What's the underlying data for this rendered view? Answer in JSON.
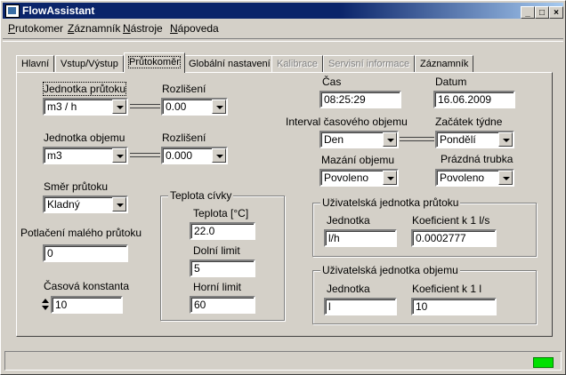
{
  "window": {
    "title": "FlowAssistant",
    "minimize": "_",
    "maximize": "□",
    "close": "×"
  },
  "menu": [
    {
      "label": "Prutokomer",
      "accel": "P",
      "rest": "rutokomer"
    },
    {
      "label": "Záznamník",
      "accel": "Z",
      "rest": "áznamník"
    },
    {
      "label": "Nástroje",
      "accel": "N",
      "rest": "ástroje"
    },
    {
      "label": "Nápoveda",
      "accel": "N",
      "rest": "ápoveda"
    }
  ],
  "tabs": [
    {
      "label": "Hlavní",
      "state": "normal"
    },
    {
      "label": "Vstup/Výstup",
      "state": "normal"
    },
    {
      "label": "Průtokoměr",
      "state": "active"
    },
    {
      "label": "Globální nastavení",
      "state": "normal"
    },
    {
      "label": "Kalibrace",
      "state": "disabled"
    },
    {
      "label": "Servisní informace",
      "state": "disabled"
    },
    {
      "label": "Záznamník",
      "state": "normal"
    }
  ],
  "flow_unit": {
    "label": "Jednotka průtoku",
    "value": "m3 / h",
    "res_label": "Rozlišení",
    "res_value": "0.00"
  },
  "volume_unit": {
    "label": "Jednotka objemu",
    "value": "m3",
    "res_label": "Rozlišení",
    "res_value": "0.000"
  },
  "direction": {
    "label": "Směr průtoku",
    "value": "Kladný"
  },
  "low_flow": {
    "label": "Potlačení malého průtoku",
    "value": "0"
  },
  "time_constant": {
    "label": "Časová konstanta",
    "value": "10"
  },
  "coil_temp": {
    "title": "Teplota cívky",
    "temp_label": "Teplota [°C]",
    "temp_value": "22.0",
    "low_label": "Dolní limit",
    "low_value": "5",
    "high_label": "Horní limit",
    "high_value": "60"
  },
  "time": {
    "label": "Čas",
    "value": "08:25:29"
  },
  "date": {
    "label": "Datum",
    "value": "16.06.2009"
  },
  "interval": {
    "label": "Interval časového objemu",
    "value": "Den"
  },
  "week_start": {
    "label": "Začátek týdne",
    "value": "Pondělí"
  },
  "vol_clear": {
    "label": "Mazání objemu",
    "value": "Povoleno"
  },
  "empty_pipe": {
    "label": "Prázdná trubka",
    "value": "Povoleno"
  },
  "user_flow_unit": {
    "title": "Uživatelská jednotka průtoku",
    "unit_label": "Jednotka",
    "unit_value": "l/h",
    "coef_label": "Koeficient k 1 l/s",
    "coef_value": "0.0002777"
  },
  "user_vol_unit": {
    "title": "Uživatelská jednotka objemu",
    "unit_label": "Jednotka",
    "unit_value": "l",
    "coef_label": "Koeficient k 1 l",
    "coef_value": "10"
  },
  "colors": {
    "titlebar": "#0a246a",
    "face": "#d4d0c8",
    "status_led": "#00e000"
  }
}
